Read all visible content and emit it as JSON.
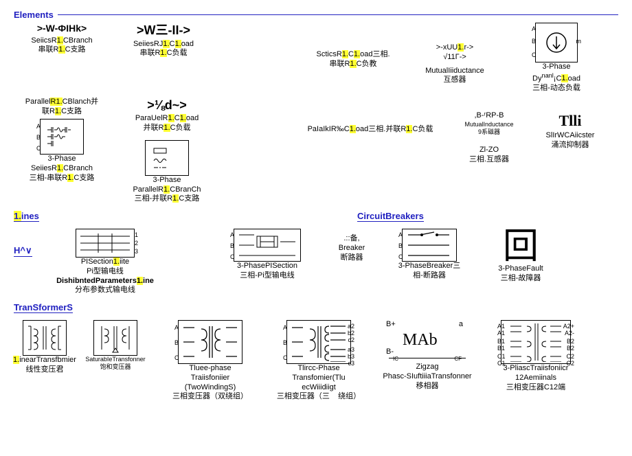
{
  "sections": {
    "elements": "Elements",
    "lines": "1.ines",
    "circuitBreakers": "CircuitBreakers",
    "transformers": "TranSformerS",
    "hv": "H^∨"
  },
  "el": {
    "e1": {
      "glyph": ">-W-ФIHk>",
      "t1": "SeiicsR1.CBranch",
      "t2": "串联R1.C支路"
    },
    "e2": {
      "glyph": ">W三-II->",
      "t1": "SeiiesRJ1.C1.oad",
      "t2": "串联R1.C负载"
    },
    "e3": {
      "t1": "ParallelR1.CBlanch并",
      "t2": "联R1.C支路"
    },
    "e4": {
      "glyph": ">⅛d~>",
      "t1": "ParaUelR1.C1.oad",
      "t2": "并联R1.C负载"
    },
    "e5": {
      "t1": "ScticsR1.C1.oad三相.",
      "t2": "串联R1.C负教"
    },
    "e6": {
      "glyph": ">-xUU1.r->",
      "glyph2": "√11Γ->",
      "t1": "MutualIiiductance",
      "t2": "互感器"
    },
    "e7": {
      "t1": "3-Phase",
      "t2": "Dyⁿᵃⁿˡ¡C1.oad",
      "t3": "三相-动态负载"
    },
    "e8": {
      "t1": "3-Phase",
      "t2": "SeiiesR1.CBranch",
      "t3": "三相-串联R1.C支路"
    },
    "e9": {
      "t1": "3-Phase",
      "t2": "ParallelR1.CBranCh",
      "t3": "三相-并联R1.C支路"
    },
    "e10": {
      "t1": "PaIaIkIR‰C1.oad三相.并联R1.C负载"
    },
    "e11": {
      "glyph": ",B-ʳRP-B",
      "t1": "MutualInductance",
      "t2": "9系磁器"
    },
    "e12": {
      "t1": "Zl-ZO",
      "t2": "三相.互感器"
    },
    "e13": {
      "glyph": "Tlli",
      "t1": "SlIrWCAiicster",
      "t2": "涌流抑制器"
    }
  },
  "ln": {
    "l1": {
      "t1": "PISection1.iite",
      "t2": "Pi型输电线",
      "t3": "DishibntedParameters1.ine",
      "t4": "分布参数式输电线"
    },
    "l2": {
      "t1": "3-PhasePISection",
      "t2": "三相-Pi型输电线"
    }
  },
  "cb": {
    "c1": {
      "glyph": ".::备,",
      "t1": "Breaker",
      "t2": "断路器"
    },
    "c2": {
      "t1": "3-PhaseBreaker三",
      "t2": "相-断路器"
    },
    "c3": {
      "t1": "3-PhaseFault",
      "t2": "三相-故障器",
      "glyph": "回"
    }
  },
  "tf": {
    "t0": {
      "t1": "1.inearTransfbmier",
      "t2": "线性变压君",
      "t3": "SaturabIeTransfonner",
      "t4": "饱和变压器"
    },
    "t1": {
      "t1": "Tluee-phase",
      "t2": "Traiisfoniier",
      "t3": "(TwoWindingS)",
      "t4": "三相变压器（双绕组）"
    },
    "t2": {
      "t1": "Tlircc-Phase",
      "t2": "Transfomier(Tlu",
      "t3": "ecWiiidiigt",
      "t4": "三相变压器（三",
      "t5": "绕组）"
    },
    "t3": {
      "pBp": "B+",
      "pA": "a",
      "glyph": "MAb",
      "pBm": "B-",
      "pIC": "IC",
      "pCF": "CF",
      "t1": "Zigzag",
      "t2": "Phasc-SIuftiiiaTransfonner",
      "t3": "移相器"
    },
    "t4": {
      "t1": "3-PliascTraiisfoniicr",
      "t2": "12Aemiinals",
      "t3": "三相变压器C12端"
    }
  },
  "ports": {
    "A": "A",
    "B": "B",
    "C": "C",
    "m": "m"
  }
}
